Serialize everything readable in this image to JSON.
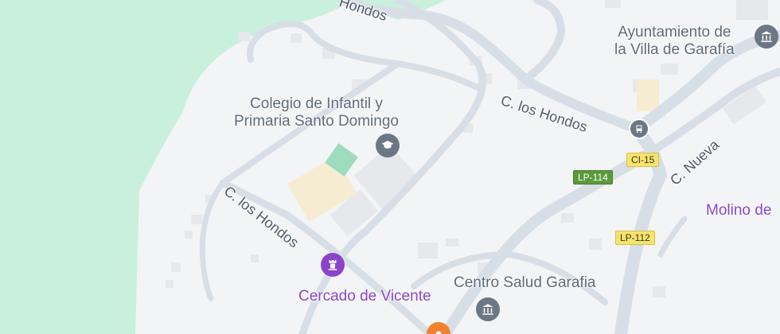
{
  "map": {
    "labels": {
      "ayuntamiento": "Ayuntamiento de\nla Villa de Garafía",
      "colegio": "Colegio de Infantil y\nPrimaria Santo Domingo",
      "centro_salud": "Centro Salud Garafia",
      "cercado": "Cercado de Vicente",
      "molino": "Molino de"
    },
    "streets": {
      "hondos_top": "Hondos",
      "hondos_mid": "C. los Hondos",
      "hondos_left": "C. los Hondos",
      "nueva": "C. Nueva"
    },
    "shields": {
      "ci15": "CI-15",
      "lp114": "LP-114",
      "lp112": "LP-112"
    },
    "colors": {
      "background": "#f3f4f6",
      "green_area": "#c9f0dc",
      "road": "#d7dee6",
      "poi_purple": "#8a44c9",
      "pin_gray": "#6b7785",
      "pin_orange": "#f0812e"
    },
    "icons": [
      "school-icon",
      "town-hall-icon",
      "health-center-icon",
      "monument-icon",
      "bus-stop-icon",
      "poi-orange-icon"
    ]
  }
}
